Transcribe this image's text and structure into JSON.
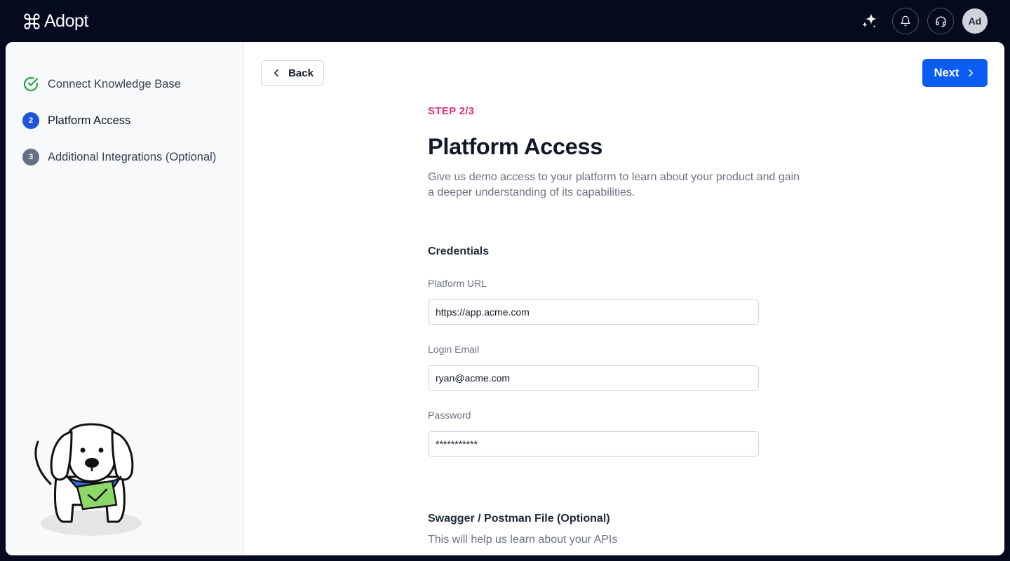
{
  "app": {
    "name": "Adopt"
  },
  "topbar": {
    "icons": [
      "sparkle-icon",
      "bell-icon",
      "headset-icon"
    ],
    "avatar_initials": "Ad"
  },
  "sidebar": {
    "steps": [
      {
        "number": "",
        "label": "Connect Knowledge Base",
        "status": "complete"
      },
      {
        "number": "2",
        "label": "Platform Access",
        "status": "active"
      },
      {
        "number": "3",
        "label": "Additional Integrations (Optional)",
        "status": "pending"
      }
    ]
  },
  "nav": {
    "back_label": "Back",
    "next_label": "Next"
  },
  "main": {
    "step_tag": "STEP 2/3",
    "title": "Platform Access",
    "description": "Give us demo access to your platform to learn about your product and gain a deeper understanding of its capabilities.",
    "credentials_title": "Credentials",
    "fields": {
      "platform_url": {
        "label": "Platform URL",
        "value": "https://app.acme.com"
      },
      "login_email": {
        "label": "Login Email",
        "value": "ryan@acme.com"
      },
      "password": {
        "label": "Password",
        "value": "***********"
      }
    },
    "swagger_title": "Swagger / Postman File (Optional)",
    "swagger_desc": "This will help us learn about your APIs"
  },
  "colors": {
    "topbar_bg": "#050a1f",
    "primary": "#0a5cf5",
    "step_tag": "#e0307a",
    "complete_green": "#22a447",
    "active_step": "#1d56d8"
  }
}
